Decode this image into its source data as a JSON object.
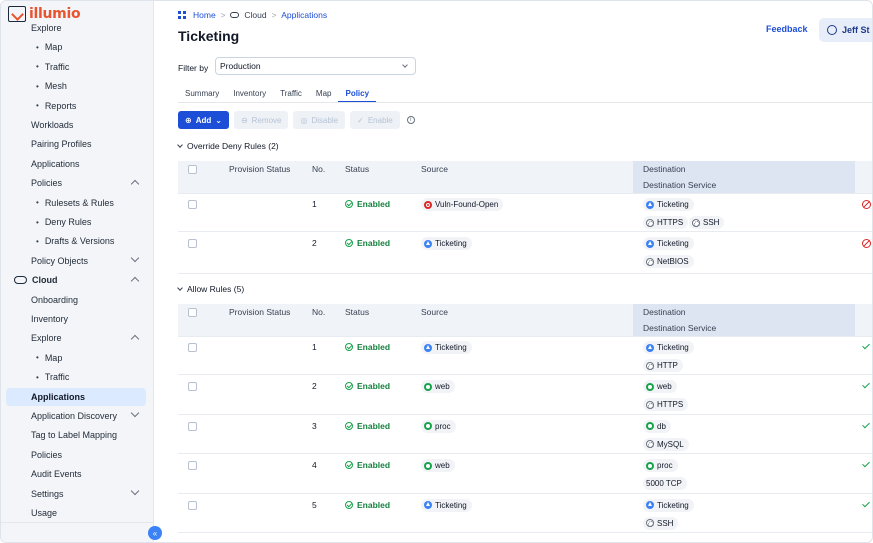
{
  "brand": {
    "logo_text": "illumio"
  },
  "sidebar": {
    "items": [
      {
        "label": "Explore",
        "kind": "l1",
        "y": 18
      },
      {
        "label": "Map",
        "kind": "sub"
      },
      {
        "label": "Traffic",
        "kind": "sub"
      },
      {
        "label": "Mesh",
        "kind": "sub"
      },
      {
        "label": "Reports",
        "kind": "sub"
      },
      {
        "label": "Workloads",
        "kind": "l1"
      },
      {
        "label": "Pairing Profiles",
        "kind": "l1"
      },
      {
        "label": "Applications",
        "kind": "l1"
      },
      {
        "label": "Policies",
        "kind": "l1",
        "chevron": "up"
      },
      {
        "label": "Rulesets & Rules",
        "kind": "sub"
      },
      {
        "label": "Deny Rules",
        "kind": "sub"
      },
      {
        "label": "Drafts & Versions",
        "kind": "sub"
      },
      {
        "label": "Policy Objects",
        "kind": "l1",
        "chevron": "down"
      },
      {
        "label": "Cloud",
        "kind": "top",
        "chevron": "up"
      },
      {
        "label": "Onboarding",
        "kind": "l1"
      },
      {
        "label": "Inventory",
        "kind": "l1"
      },
      {
        "label": "Explore",
        "kind": "l1",
        "chevron": "up"
      },
      {
        "label": "Map",
        "kind": "sub"
      },
      {
        "label": "Traffic",
        "kind": "sub"
      },
      {
        "label": "Applications",
        "kind": "l1",
        "active": true
      },
      {
        "label": "Application Discovery",
        "kind": "l1",
        "chevron": "down"
      },
      {
        "label": "Tag to Label Mapping",
        "kind": "l1"
      },
      {
        "label": "Policies",
        "kind": "l1"
      },
      {
        "label": "Audit Events",
        "kind": "l1"
      },
      {
        "label": "Settings",
        "kind": "l1",
        "chevron": "down"
      },
      {
        "label": "Usage",
        "kind": "l1"
      }
    ],
    "collapse_label": "«"
  },
  "breadcrumb": {
    "home": "Home",
    "cloud": "Cloud",
    "current": "Applications",
    "sep": ">"
  },
  "page_title": "Ticketing",
  "header": {
    "feedback": "Feedback",
    "user": "Jeff St"
  },
  "filter": {
    "label": "Filter by",
    "value": "Production"
  },
  "tabs": [
    "Summary",
    "Inventory",
    "Traffic",
    "Map",
    "Policy"
  ],
  "active_tab": "Policy",
  "toolbar": {
    "add": "Add",
    "remove": "Remove",
    "disable": "Disable",
    "enable": "Enable"
  },
  "columns": {
    "provision_status": "Provision Status",
    "no": "No.",
    "status": "Status",
    "source": "Source",
    "destination": "Destination",
    "destination_service": "Destination Service"
  },
  "deny_section": {
    "title": "Override Deny Rules (2)",
    "rows": [
      {
        "no": "1",
        "status": "Enabled",
        "source": {
          "type": "vuln",
          "label": "Vuln-Found-Open"
        },
        "destination": {
          "type": "app",
          "label": "Ticketing"
        },
        "services": [
          "HTTPS",
          "SSH"
        ]
      },
      {
        "no": "2",
        "status": "Enabled",
        "source": {
          "type": "app",
          "label": "Ticketing"
        },
        "destination": {
          "type": "app",
          "label": "Ticketing"
        },
        "services": [
          "NetBIOS"
        ]
      }
    ]
  },
  "allow_section": {
    "title": "Allow Rules (5)",
    "rows": [
      {
        "no": "1",
        "status": "Enabled",
        "source": {
          "type": "app",
          "label": "Ticketing"
        },
        "destination": {
          "type": "app",
          "label": "Ticketing"
        },
        "services": [
          "HTTP"
        ]
      },
      {
        "no": "2",
        "status": "Enabled",
        "source": {
          "type": "role",
          "label": "web"
        },
        "destination": {
          "type": "role",
          "label": "web"
        },
        "services": [
          "HTTPS"
        ]
      },
      {
        "no": "3",
        "status": "Enabled",
        "source": {
          "type": "role",
          "label": "proc"
        },
        "destination": {
          "type": "role",
          "label": "db"
        },
        "services": [
          "MySQL"
        ]
      },
      {
        "no": "4",
        "status": "Enabled",
        "source": {
          "type": "role",
          "label": "web"
        },
        "destination": {
          "type": "role",
          "label": "proc"
        },
        "services": [
          "5000 TCP"
        ],
        "plain_service": true
      },
      {
        "no": "5",
        "status": "Enabled",
        "source": {
          "type": "app",
          "label": "Ticketing"
        },
        "destination": {
          "type": "app",
          "label": "Ticketing"
        },
        "services": [
          "SSH"
        ]
      }
    ]
  }
}
